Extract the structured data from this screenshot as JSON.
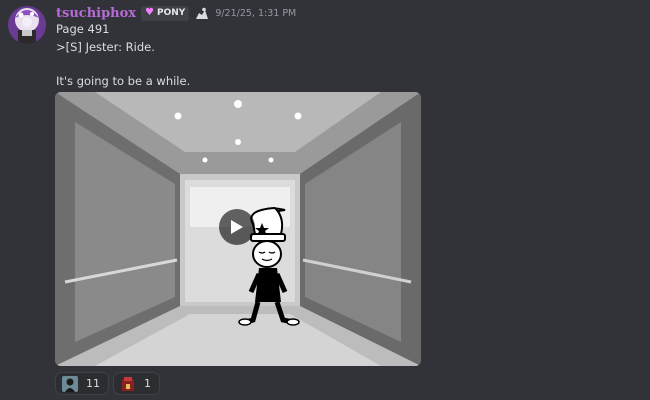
{
  "author": {
    "username": "tsuchiphox",
    "tag": "PONY",
    "tag_icon": "heart-icon",
    "timestamp": "9/21/25, 1:31 PM",
    "name_color": "#b86bd6"
  },
  "message": {
    "lines": [
      "Page 491",
      ">[S] Jester: Ride.",
      "It's going to be a while."
    ]
  },
  "embed": {
    "type": "video",
    "play_icon": "play-icon"
  },
  "reactions": [
    {
      "icon": "dark-figure-emoji",
      "count": "11"
    },
    {
      "icon": "red-box-emoji",
      "count": "1"
    }
  ],
  "colors": {
    "background": "#313338",
    "text": "#dbdee1",
    "muted": "#949ba4"
  }
}
